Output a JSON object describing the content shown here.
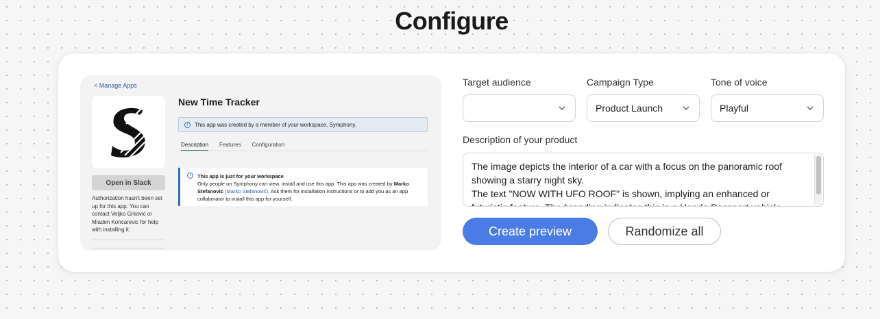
{
  "header": {
    "title": "Configure"
  },
  "preview": {
    "back_link": "< Manage Apps",
    "app_title": "New Time Tracker",
    "info_banner": "This app was created by a member of your workspace, Symphony.",
    "tabs": [
      {
        "label": "Description"
      },
      {
        "label": "Features"
      },
      {
        "label": "Configuration"
      }
    ],
    "open_button": "Open in Slack",
    "auth_note": "Authorization hasn't been set up for this app. You can contact Veljko Grković or Mladen Koncarevic for help with installing it.",
    "notice": {
      "title": "This app is just for your workspace",
      "line1_prefix": "Only people on Symphony can view, install and use this app. This app was created by ",
      "creator_bold": "Marko Stefanovic",
      "creator_link": "(Marko Stefanović)",
      "line_suffix": ". Ask them for installation instructions or to add you as an app collaborator to install this app for yourself."
    }
  },
  "form": {
    "target_audience": {
      "label": "Target audience",
      "value": ""
    },
    "campaign_type": {
      "label": "Campaign Type",
      "value": "Product Launch"
    },
    "tone_of_voice": {
      "label": "Tone of voice",
      "value": "Playful"
    },
    "description": {
      "label": "Description of your product",
      "line1": "The image depicts the interior of a car with a focus on the panoramic roof showing a starry night sky.",
      "line2": "The text \"NOW WITH UFO ROOF\" is shown, implying an enhanced or futuristic feature. The branding indicates this is a Honda Passport vehicle."
    },
    "create_button": "Create preview",
    "randomize_button": "Randomize all"
  },
  "colors": {
    "primary": "#4b7be5",
    "slack_link": "#2d5e9c",
    "slack_accent": "#1d7a5c"
  },
  "icons": [
    "chevron-down-icon",
    "info-icon",
    "app-logo"
  ]
}
